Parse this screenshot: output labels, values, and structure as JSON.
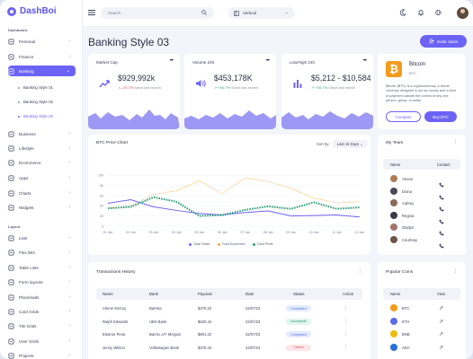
{
  "app": {
    "name": "DashBoi"
  },
  "sidebar": {
    "dashboard_title": "Dashboard",
    "dashboard_items": [
      {
        "label": "Personal",
        "icon": "user-icon"
      },
      {
        "label": "Finance",
        "icon": "wallet-icon"
      },
      {
        "label": "Banking",
        "icon": "bank-icon",
        "active": true
      }
    ],
    "banking_sub": [
      "Banking Style 01",
      "Banking Style 02",
      "Banking Style 03"
    ],
    "more_items": [
      {
        "label": "Business",
        "icon": "briefcase-icon"
      },
      {
        "label": "Lifestyle",
        "icon": "heart-icon"
      },
      {
        "label": "Ecommerce",
        "icon": "cart-icon"
      },
      {
        "label": "Apps",
        "icon": "grid-icon"
      },
      {
        "label": "Charts",
        "icon": "chart-icon"
      },
      {
        "label": "Widgets",
        "icon": "widget-icon"
      }
    ],
    "layout_title": "Layout",
    "layout_items": [
      {
        "label": "Lists",
        "icon": "list-icon"
      },
      {
        "label": "Flex lists",
        "icon": "flex-list-icon"
      },
      {
        "label": "Table Lists",
        "icon": "table-icon"
      },
      {
        "label": "Form layouts",
        "icon": "form-icon"
      },
      {
        "label": "Placeloads",
        "icon": "placeload-icon"
      },
      {
        "label": "Card Grids",
        "icon": "card-grid-icon"
      },
      {
        "label": "Tile Grids",
        "icon": "tile-grid-icon"
      },
      {
        "label": "User Grids",
        "icon": "user-grid-icon"
      },
      {
        "label": "Projects",
        "icon": "project-icon"
      }
    ]
  },
  "header": {
    "search_placeholder": "Search",
    "layout_select": "Vertical"
  },
  "page": {
    "title": "Banking Style 03",
    "invite_label": "Invite Users"
  },
  "stats": [
    {
      "label": "Market Cap",
      "value": "$929,992k",
      "change": "-29.7%",
      "change_dir": "down",
      "note": "Since last month",
      "icon": "trend-up-icon"
    },
    {
      "label": "Volume 24h",
      "value": "$453,178K",
      "change": "+00.7%",
      "change_dir": "up",
      "note": "Since last month",
      "icon": "volume-icon"
    },
    {
      "label": "Low/High 24h",
      "value": "$5,212 - $10,584",
      "change": "+00.7%",
      "change_dir": "up",
      "note": "Since last month",
      "icon": "bar-chart-icon"
    }
  ],
  "coin_card": {
    "name": "Bitcoin",
    "ticker": "BTC",
    "description": "Bitcoin (BTC) is a cryptocurrency, a virtual currency designed to act as money and a form of payment outside the control of any one person, group, or entity.",
    "compare_label": "Compare",
    "buy_label": "Buy BTC"
  },
  "price_chart": {
    "title": "BTC Price Chart",
    "sort_label": "Sort By",
    "sort_value": "Last 15 Days"
  },
  "chart_data": {
    "type": "line",
    "x": [
      "01 Jan",
      "02 Jan",
      "03 Jan",
      "04 Jan",
      "05 Jan",
      "06 Jan",
      "07 Jan",
      "08 Jan",
      "09 Jan",
      "10 Jan",
      "11 Jan",
      "12 Jan"
    ],
    "ylim": [
      0,
      120
    ],
    "yticks": [
      0,
      20,
      40,
      60,
      80,
      100
    ],
    "series": [
      {
        "name": "Total Sales",
        "color": "#6c63f5",
        "style": "solid",
        "values": [
          45,
          52,
          38,
          31,
          25,
          22,
          27,
          30,
          20,
          21,
          22,
          18
        ]
      },
      {
        "name": "Total Expensed",
        "color": "#f5a844",
        "style": "dotted",
        "values": [
          35,
          41,
          62,
          70,
          89,
          64,
          95,
          88,
          74,
          55,
          46,
          48
        ]
      },
      {
        "name": "Total Profit",
        "color": "#2e9e78",
        "style": "dashed",
        "values": [
          35,
          38,
          57,
          48,
          20,
          22,
          32,
          39,
          34,
          47,
          34,
          37
        ]
      }
    ]
  },
  "team": {
    "title": "My Team",
    "col_name": "Name",
    "col_contact": "Contact",
    "members": [
      "Ahono",
      "Diona",
      "Aubrey",
      "Regina",
      "Gladys",
      "Courtney"
    ],
    "avatar_colors": [
      "#b07a5a",
      "#4e4a5c",
      "#8a6a5a",
      "#3d3a48",
      "#a4746a",
      "#6d5447"
    ]
  },
  "transactions": {
    "title": "Transactions History",
    "columns": [
      "Name",
      "Bank",
      "Payouts",
      "Date",
      "Status",
      "Action"
    ],
    "rows": [
      {
        "name": "Arlene McCoy",
        "bank": "Barreta",
        "payout": "$475.22",
        "date": "22/07/23",
        "status": "Completed",
        "status_color": "blue"
      },
      {
        "name": "Ralph Edwards",
        "bank": "UBS Bank",
        "payout": "$630.44",
        "date": "22/07/23",
        "status": "Incomplete",
        "status_color": "green"
      },
      {
        "name": "Eleanor Pena",
        "bank": "Barclu J.P. Morgan",
        "payout": "$801.22",
        "date": "22/07/23",
        "status": "Completed",
        "status_color": "blue"
      },
      {
        "name": "Jenny Wilson",
        "bank": "Volkswagen Bank",
        "payout": "$275.43",
        "date": "22/07/23",
        "status": "Cancel",
        "status_color": "red"
      }
    ]
  },
  "coins": {
    "title": "Popular Coins",
    "col_name": "Name",
    "col_view": "View",
    "items": [
      {
        "symbol": "BTC",
        "color": "#f39b1b"
      },
      {
        "symbol": "ETH",
        "color": "#5b6ae8"
      },
      {
        "symbol": "BNB",
        "color": "#f0b90b"
      },
      {
        "symbol": "ADA",
        "color": "#2a6fd6"
      }
    ]
  }
}
